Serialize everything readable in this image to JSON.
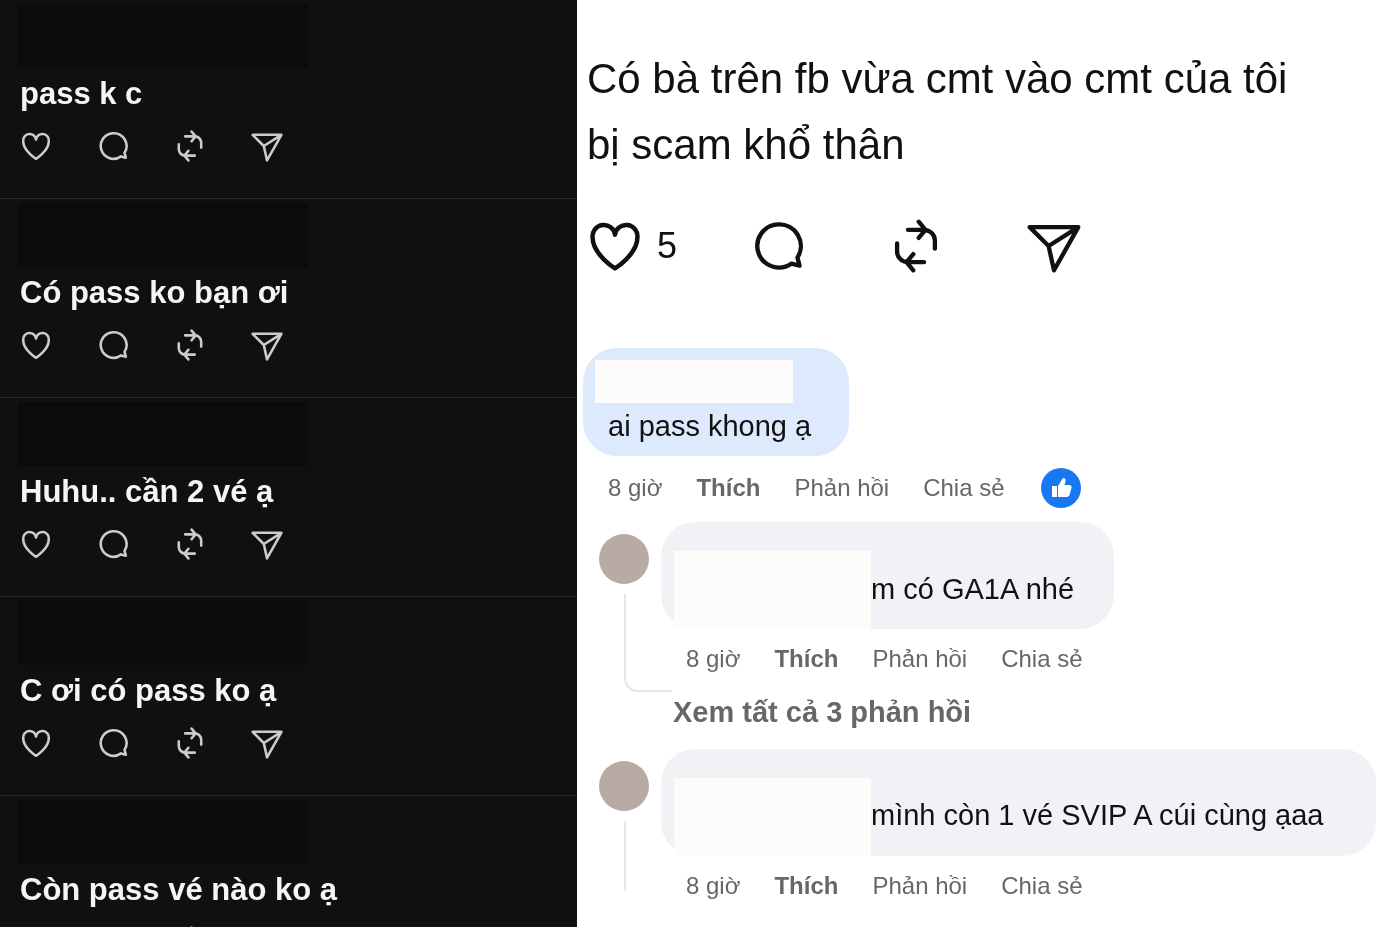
{
  "threads_feed": {
    "posts": [
      {
        "text": "pass k c"
      },
      {
        "text": "Có pass ko bạn ơi"
      },
      {
        "text": "Huhu.. cần 2 vé ạ"
      },
      {
        "text": "C ơi có pass ko ạ"
      },
      {
        "text": "Còn pass vé nào ko ạ"
      }
    ]
  },
  "post": {
    "text": "Có bà trên fb vừa cmt vào cmt của tôi bị scam khổ thân",
    "like_count": "5"
  },
  "comments": [
    {
      "kind": "top",
      "highlighted": true,
      "text": "ai pass khong ạ",
      "time": "8 giờ",
      "like": "Thích",
      "reply": "Phản hồi",
      "share": "Chia sẻ",
      "reaction": true
    },
    {
      "kind": "reply",
      "highlighted": false,
      "text": "m có GA1A nhé",
      "time": "8 giờ",
      "like": "Thích",
      "reply": "Phản hồi",
      "share": "Chia sẻ",
      "reaction": false,
      "view_replies": "Xem tất cả 3 phản hồi"
    },
    {
      "kind": "reply",
      "highlighted": false,
      "text": "mình còn 1 vé SVIP A cúi cùng ạaa",
      "time": "8 giờ",
      "like": "Thích",
      "reply": "Phản hồi",
      "share": "Chia sẻ",
      "reaction": false
    }
  ]
}
